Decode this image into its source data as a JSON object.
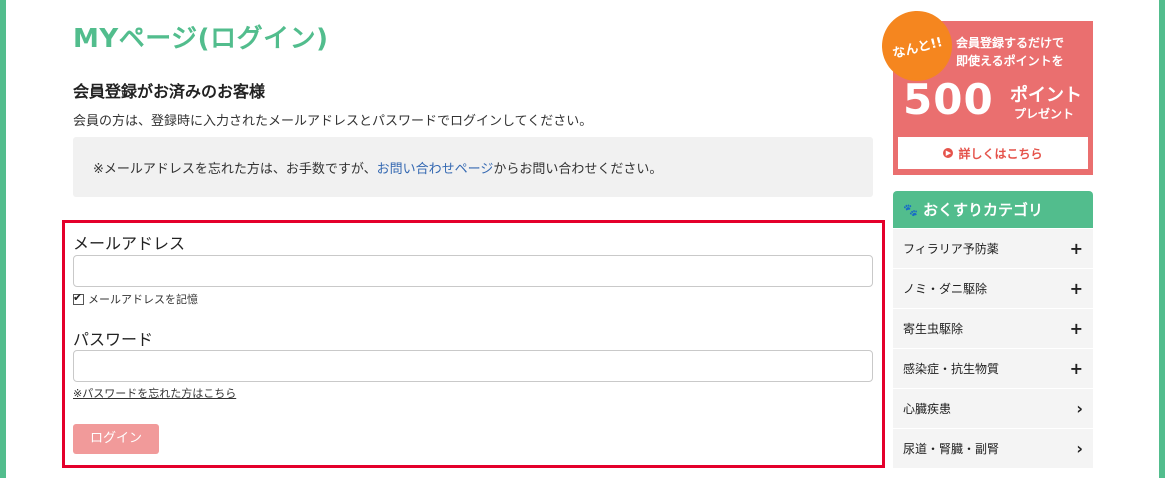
{
  "page_title": "MYページ(ログイン)",
  "section_heading": "会員登録がお済みのお客様",
  "intro_text": "会員の方は、登録時に入力されたメールアドレスとパスワードでログインしてください。",
  "notice": {
    "prefix": "※メールアドレスを忘れた方は、お手数ですが、",
    "link": "お問い合わせページ",
    "suffix": "からお問い合わせください。"
  },
  "login_form": {
    "email_label": "メールアドレス",
    "email_value": "",
    "remember_label": "メールアドレスを記憶",
    "remember_checked": true,
    "password_label": "パスワード",
    "password_value": "",
    "forgot_password": "※パスワードを忘れた方はこちら",
    "submit": "ログイン"
  },
  "promo": {
    "badge": "なんと!!",
    "line1": "会員登録するだけで",
    "line2": "即使えるポイントを",
    "points": "500",
    "unit": "ポイント",
    "sub": "プレゼント",
    "button": "詳しくはこちら"
  },
  "category": {
    "title": "おくすりカテゴリ",
    "items": [
      {
        "label": "フィラリア予防薬",
        "icon": "plus-icon",
        "glyph": "+"
      },
      {
        "label": "ノミ・ダニ駆除",
        "icon": "plus-icon",
        "glyph": "+"
      },
      {
        "label": "寄生虫駆除",
        "icon": "plus-icon",
        "glyph": "+"
      },
      {
        "label": "感染症・抗生物質",
        "icon": "plus-icon",
        "glyph": "+"
      },
      {
        "label": "心臓疾患",
        "icon": "chevron-right-icon",
        "glyph": "›"
      },
      {
        "label": "尿道・腎臓・副腎",
        "icon": "chevron-right-icon",
        "glyph": "›"
      }
    ]
  },
  "colors": {
    "brand_green": "#52bd8d",
    "highlight_red": "#e4002b",
    "button_pink": "#f19a9a",
    "promo_red": "#ea6f6f",
    "badge_orange": "#f5861f",
    "link_blue": "#3569b2"
  }
}
